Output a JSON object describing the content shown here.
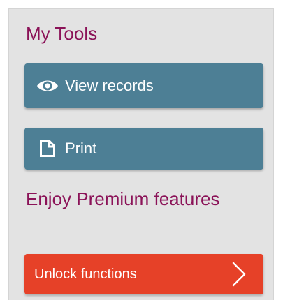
{
  "my_tools": {
    "title": "My Tools",
    "buttons": [
      {
        "label": "View records",
        "icon": "eye-icon"
      },
      {
        "label": "Print",
        "icon": "document-icon"
      }
    ]
  },
  "premium": {
    "title": "Enjoy Premium features",
    "cta": {
      "label": "Unlock functions",
      "icon": "chevron-right-icon"
    }
  },
  "colors": {
    "heading": "#8b1358",
    "tool_button": "#4d7f95",
    "cta_button": "#e64128",
    "panel_bg": "#e3e3e3"
  }
}
